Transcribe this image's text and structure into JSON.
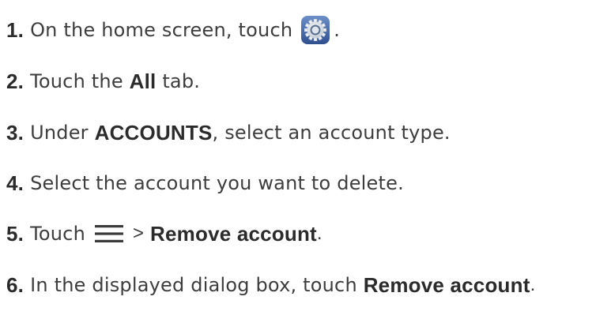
{
  "steps": [
    {
      "num": "1.",
      "text_a": "On the home screen, touch",
      "text_b": "."
    },
    {
      "num": "2.",
      "text_a": "Touch the",
      "bold": "All",
      "text_b": "tab."
    },
    {
      "num": "3.",
      "text_a": "Under",
      "bold": "ACCOUNTS",
      "text_b": ", select an account type."
    },
    {
      "num": "4.",
      "text_a": "Select the account you want to delete."
    },
    {
      "num": "5.",
      "text_a": "Touch",
      "gt": ">",
      "bold": "Remove account",
      "text_b": "."
    },
    {
      "num": "6.",
      "text_a": "In the displayed dialog box, touch",
      "bold": "Remove account",
      "text_b": "."
    }
  ],
  "icons": {
    "settings": "settings-gear-icon",
    "menu": "menu-icon"
  }
}
